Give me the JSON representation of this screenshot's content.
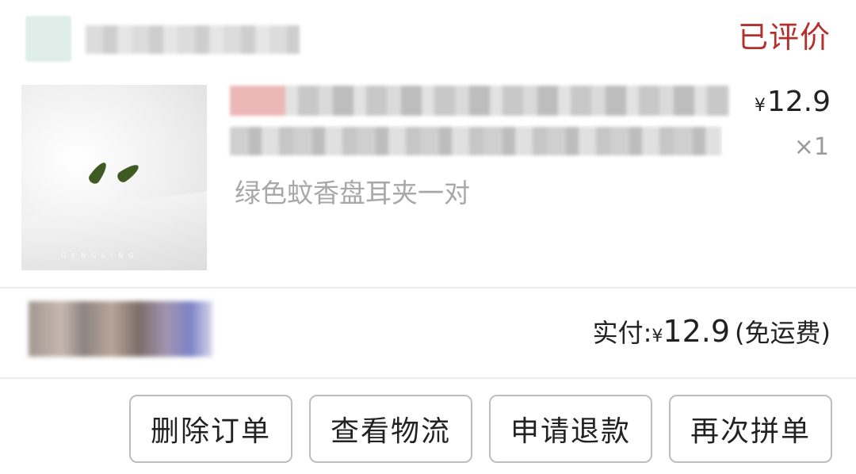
{
  "header": {
    "status": "已评价"
  },
  "product": {
    "spec": "绿色蚊香盘耳夹一对",
    "brand_mark": "GENGLING",
    "currency": "¥",
    "unit_price": "12.9",
    "quantity": "×1"
  },
  "payment": {
    "label": "实付:",
    "currency": "¥",
    "amount": "12.9",
    "shipping_note": "(免运费)"
  },
  "actions": {
    "delete_label": "删除订单",
    "logistics_label": "查看物流",
    "refund_label": "申请退款",
    "reorder_label": "再次拼单"
  },
  "colors": {
    "status_red": "#b3302c",
    "text_dark": "#222222",
    "text_muted": "#a8a8a8",
    "button_border": "#bdbdbd"
  }
}
